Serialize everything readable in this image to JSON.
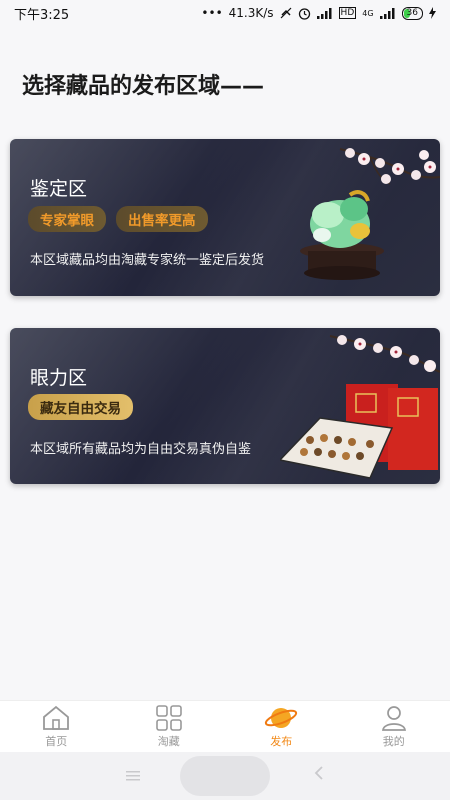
{
  "status_bar": {
    "time": "下午3:25",
    "speed": "41.3K/s",
    "signal_icons": [
      "alarm-icon",
      "signal-icon"
    ],
    "hd": "HD",
    "network": "4G",
    "battery": "36"
  },
  "page_title": "选择藏品的发布区域——",
  "cards": [
    {
      "title": "鉴定区",
      "tags": [
        "专家掌眼",
        "出售率更高"
      ],
      "description": "本区域藏品均由淘藏专家统一鉴定后发货"
    },
    {
      "title": "眼力区",
      "tags": [
        "藏友自由交易"
      ],
      "description": "本区域所有藏品均为自由交易真伪自鉴"
    }
  ],
  "tabbar": {
    "items": [
      {
        "label": "首页",
        "icon": "home-icon"
      },
      {
        "label": "淘藏",
        "icon": "grid-icon"
      },
      {
        "label": "发布",
        "icon": "planet-icon"
      },
      {
        "label": "我的",
        "icon": "user-icon"
      }
    ],
    "active_index": 2,
    "active_color": "#f28a1a"
  },
  "colors": {
    "card_bg": "#2b2e40",
    "tag_orange": "#f19a2a",
    "tag_gold": "#e3bf6b"
  }
}
